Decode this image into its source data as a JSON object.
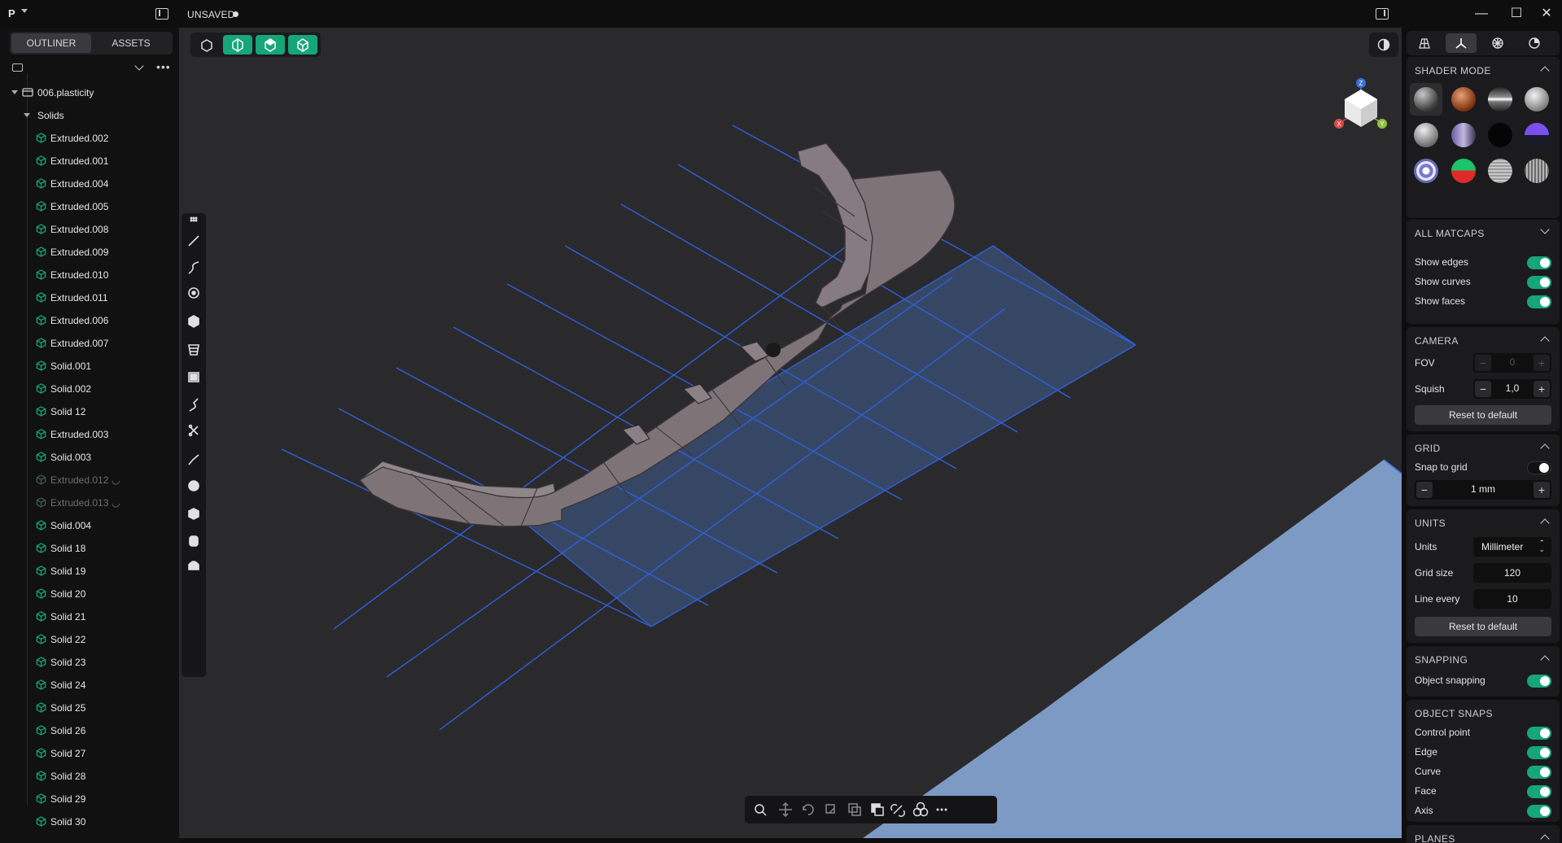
{
  "app": {
    "logo": "P",
    "doc_title": "UNSAVED"
  },
  "window_controls": {
    "minimize": "—",
    "maximize": "☐",
    "close": "✕"
  },
  "sidebar": {
    "tabs": [
      {
        "label": "OUTLINER",
        "active": true
      },
      {
        "label": "ASSETS",
        "active": false
      }
    ],
    "tree": [
      {
        "label": "006.plasticity",
        "level": 0,
        "type": "file"
      },
      {
        "label": "Solids",
        "level": 1,
        "type": "group"
      },
      {
        "label": "Extruded.002",
        "level": 2,
        "type": "solid"
      },
      {
        "label": "Extruded.001",
        "level": 2,
        "type": "solid"
      },
      {
        "label": "Extruded.004",
        "level": 2,
        "type": "solid"
      },
      {
        "label": "Extruded.005",
        "level": 2,
        "type": "solid"
      },
      {
        "label": "Extruded.008",
        "level": 2,
        "type": "solid"
      },
      {
        "label": "Extruded.009",
        "level": 2,
        "type": "solid"
      },
      {
        "label": "Extruded.010",
        "level": 2,
        "type": "solid"
      },
      {
        "label": "Extruded.011",
        "level": 2,
        "type": "solid"
      },
      {
        "label": "Extruded.006",
        "level": 2,
        "type": "solid"
      },
      {
        "label": "Extruded.007",
        "level": 2,
        "type": "solid"
      },
      {
        "label": "Solid.001",
        "level": 2,
        "type": "solid"
      },
      {
        "label": "Solid.002",
        "level": 2,
        "type": "solid"
      },
      {
        "label": "Solid 12",
        "level": 2,
        "type": "solid"
      },
      {
        "label": "Extruded.003",
        "level": 2,
        "type": "solid"
      },
      {
        "label": "Solid.003",
        "level": 2,
        "type": "solid"
      },
      {
        "label": "Extruded.012",
        "level": 2,
        "type": "solid",
        "hidden": true
      },
      {
        "label": "Extruded.013",
        "level": 2,
        "type": "solid",
        "hidden": true
      },
      {
        "label": "Solid.004",
        "level": 2,
        "type": "solid"
      },
      {
        "label": "Solid 18",
        "level": 2,
        "type": "solid"
      },
      {
        "label": "Solid 19",
        "level": 2,
        "type": "solid"
      },
      {
        "label": "Solid 20",
        "level": 2,
        "type": "solid"
      },
      {
        "label": "Solid 21",
        "level": 2,
        "type": "solid"
      },
      {
        "label": "Solid 22",
        "level": 2,
        "type": "solid"
      },
      {
        "label": "Solid 23",
        "level": 2,
        "type": "solid"
      },
      {
        "label": "Solid 24",
        "level": 2,
        "type": "solid"
      },
      {
        "label": "Solid 25",
        "level": 2,
        "type": "solid"
      },
      {
        "label": "Solid 26",
        "level": 2,
        "type": "solid"
      },
      {
        "label": "Solid 27",
        "level": 2,
        "type": "solid"
      },
      {
        "label": "Solid 28",
        "level": 2,
        "type": "solid"
      },
      {
        "label": "Solid 29",
        "level": 2,
        "type": "solid"
      },
      {
        "label": "Solid 30",
        "level": 2,
        "type": "solid"
      }
    ]
  },
  "viewcube": {
    "z": "Z",
    "x": "X",
    "y": "Y"
  },
  "right_panel": {
    "shader_mode": {
      "title": "SHADER MODE"
    },
    "all_matcaps": {
      "title": "ALL MATCAPS"
    },
    "display": {
      "show_edges": {
        "label": "Show edges",
        "on": true
      },
      "show_curves": {
        "label": "Show curves",
        "on": true
      },
      "show_faces": {
        "label": "Show faces",
        "on": true
      }
    },
    "camera": {
      "title": "CAMERA",
      "fov_label": "FOV",
      "fov_value": "0",
      "squish_label": "Squish",
      "squish_value": "1,0",
      "reset": "Reset to default"
    },
    "grid": {
      "title": "GRID",
      "snap_label": "Snap to grid",
      "snap_on": false,
      "size_value": "1 mm"
    },
    "units": {
      "title": "UNITS",
      "units_label": "Units",
      "units_value": "Millimeter",
      "grid_size_label": "Grid size",
      "grid_size_value": "120",
      "line_every_label": "Line every",
      "line_every_value": "10",
      "reset": "Reset to default"
    },
    "snapping": {
      "title": "SNAPPING",
      "object_snapping": {
        "label": "Object snapping",
        "on": true
      }
    },
    "object_snaps": {
      "title": "OBJECT SNAPS",
      "items": [
        {
          "label": "Control point",
          "on": true
        },
        {
          "label": "Edge",
          "on": true
        },
        {
          "label": "Curve",
          "on": true
        },
        {
          "label": "Face",
          "on": true
        },
        {
          "label": "Axis",
          "on": true
        }
      ]
    },
    "planes": {
      "title": "PLANES"
    }
  },
  "colors": {
    "accent_green": "#17a677",
    "grid_blue": "#2f5fd8",
    "viewport_bg": "#2a2a2d",
    "model_gray": "#7e7478"
  }
}
